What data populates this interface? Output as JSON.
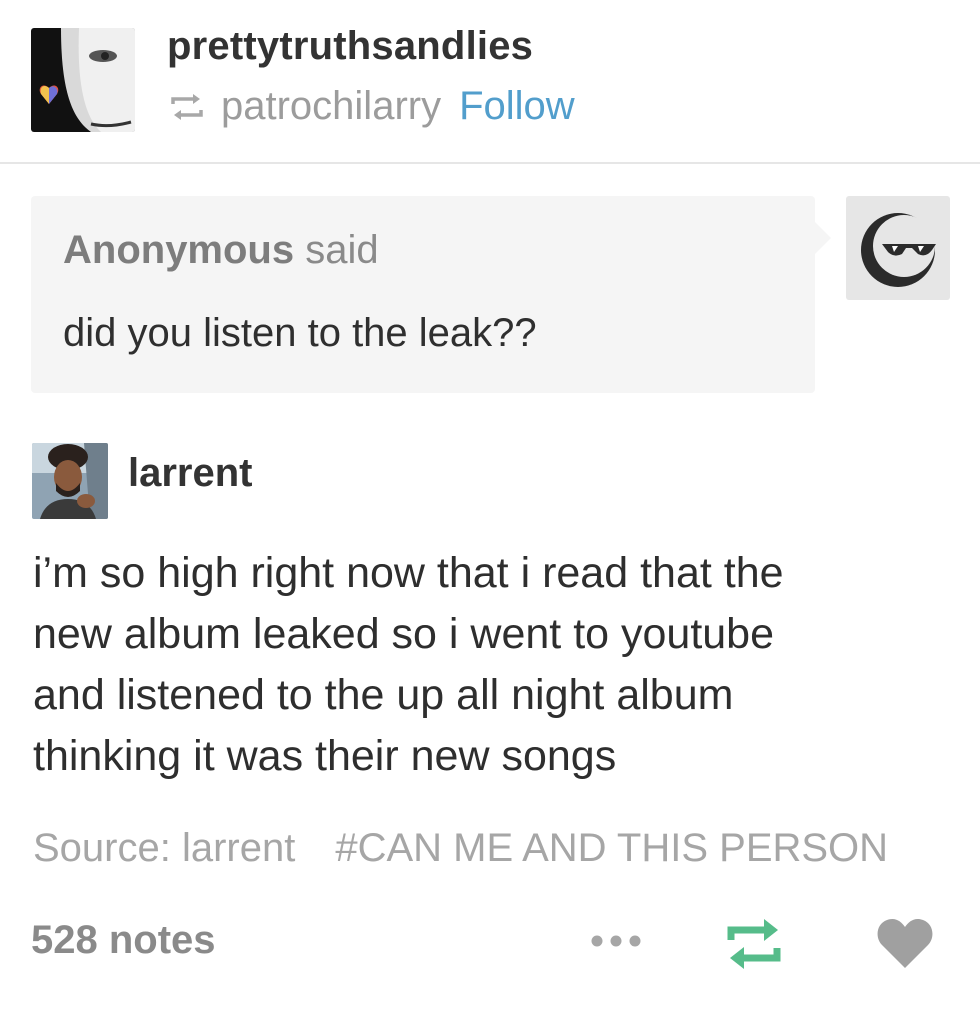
{
  "post": {
    "blog_name": "prettytruthsandlies",
    "reblogged_from": "patrochilarry",
    "follow_label": "Follow",
    "ask": {
      "asker": "Anonymous",
      "said": "said",
      "question": "did you listen to the leak??"
    },
    "answer": {
      "name": "larrent",
      "lines": [
        "i’m so high right now that i read that the",
        "new album leaked so i went to youtube",
        "and listened to the up all night album",
        "thinking it was their new songs"
      ]
    },
    "source": "Source: larrent",
    "tag": "#CAN ME AND THIS PERSON",
    "notes": "528 notes"
  },
  "icons": {
    "reblog_small": "reblog-icon",
    "more": "more-options-icon",
    "reblog": "reblog-icon",
    "like": "heart-icon",
    "asker_avatar": "sunglasses-face-icon"
  },
  "colors": {
    "follow": "#529ecc",
    "reblog_green": "#56bc8a",
    "muted": "#9c9c9c",
    "heart": "#a0a0a0"
  }
}
